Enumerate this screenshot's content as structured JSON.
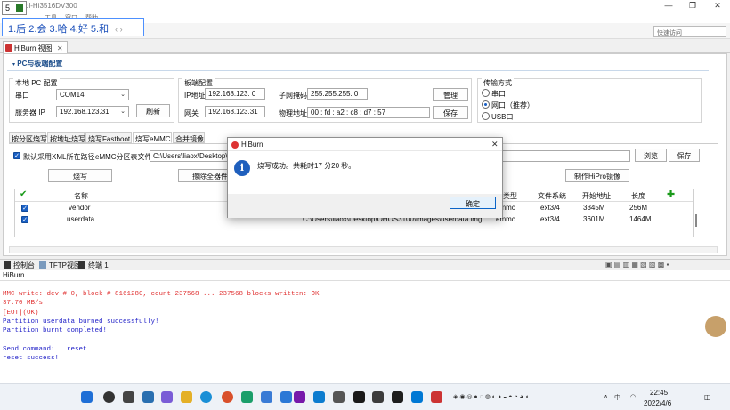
{
  "window": {
    "title": "ol-Hi3516DV300",
    "minimize_glyph": "—",
    "maximize_glyph": "❐",
    "close_glyph": "✕"
  },
  "menu": {
    "items": [
      "工具",
      "窗口",
      "帮助"
    ]
  },
  "ime": {
    "candidates": "1.后 2.会 3.哈 4.好 5.和",
    "icon_letter": "5"
  },
  "quick_access": {
    "placeholder": "快速访问"
  },
  "view_tab": {
    "label": "HiBurn 视图",
    "close_glyph": "✕"
  },
  "config": {
    "section_title": "PC与板端配置",
    "local_pc": {
      "title": "本地 PC 配置",
      "port_label": "串口",
      "port_value": "COM14",
      "server_ip_label": "服务器 IP",
      "server_ip_value": "192.168.123.31",
      "refresh_label": "刷新"
    },
    "board": {
      "title": "板端配置",
      "ip_label": "IP地址",
      "ip_value": "192.168.123. 0",
      "gateway_label": "网关",
      "gateway_value": "192.168.123.31",
      "mask_label": "子网掩码",
      "mask_value": "255.255.255. 0",
      "mac_label": "物理地址",
      "mac_value": "00 : fd : a2 : c8 : d7 : 57",
      "manage_label": "管理",
      "save_label": "保存"
    },
    "transfer": {
      "title": "传输方式",
      "options": [
        "串口",
        "网口（推荐）",
        "USB口"
      ],
      "selected_index": 1
    }
  },
  "burn_tabs": [
    "按分区烧写",
    "按地址烧写",
    "烧写Fastboot",
    "烧写eMMC",
    "合并镜像"
  ],
  "active_burn_tab": 3,
  "emmc": {
    "use_default_label": "默认采用XML所在路径",
    "table_file_label": "eMMC分区表文件",
    "table_file_value": "C:\\Users\\liaox\\Desktop\\C",
    "browse_label": "浏览",
    "save_label": "保存",
    "burn_label": "烧写",
    "erase_label": "擦除全器件",
    "make_hipro_label": "制作HiPro镜像",
    "columns": {
      "name": "名称",
      "type": "类型",
      "fs": "文件系统",
      "start": "开始地址",
      "length": "长度"
    },
    "rows": [
      {
        "name": "vendor",
        "path": "",
        "type": "emmc",
        "fs": "ext3/4",
        "start": "3345M",
        "length": "256M"
      },
      {
        "name": "userdata",
        "path": "C:\\Users\\liaox\\Desktop\\OHOS3100\\images\\userdata.img",
        "type": "emmc",
        "fs": "ext3/4",
        "start": "3601M",
        "length": "1464M"
      }
    ]
  },
  "dialog": {
    "title": "HiBurn",
    "message": "烧写成功。共耗时17 分20 秒。",
    "ok_label": "确定",
    "close_glyph": "✕",
    "info_glyph": "i"
  },
  "console": {
    "tabs": [
      "控制台",
      "TFTP视图",
      "终端 1"
    ],
    "header": "HiBurn",
    "lines": [
      {
        "text": "MMC write: dev # 0, block # 8161280, count 237568 ... 237568 blocks written: OK",
        "color": "#e03030"
      },
      {
        "text": "37.70 MB/s",
        "color": "#e03030"
      },
      {
        "text": "[EOT](OK)",
        "color": "#e03030"
      },
      {
        "text": "Partition userdata burned successfully!",
        "color": "#2222c8"
      },
      {
        "text": "Partition burnt completed!",
        "color": "#2222c8"
      },
      {
        "text": "",
        "color": "#2222c8"
      },
      {
        "text": "Send command:   reset",
        "color": "#2222c8"
      },
      {
        "text": "reset success!",
        "color": "#2222c8"
      }
    ]
  },
  "taskbar": {
    "time": "22:45",
    "date": "2022/4/6",
    "lang": "中",
    "tray_up": "∧"
  }
}
